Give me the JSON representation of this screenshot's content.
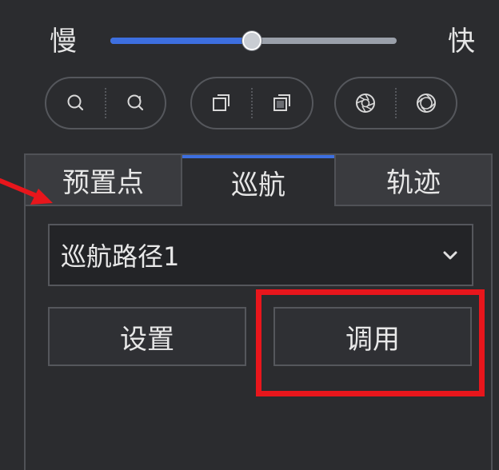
{
  "speed": {
    "slow_label": "慢",
    "fast_label": "快",
    "value_fraction": 0.495,
    "fill_color": "#3d6fe0"
  },
  "controls": {
    "zoom": {
      "in_icon": "zoom-in-icon",
      "out_icon": "zoom-out-icon"
    },
    "focus": {
      "near_icon": "focus-near-icon",
      "far_icon": "focus-far-icon"
    },
    "iris": {
      "open_icon": "iris-open-icon",
      "close_icon": "iris-close-icon"
    }
  },
  "tabs": [
    {
      "label": "预置点",
      "active": false
    },
    {
      "label": "巡航",
      "active": true
    },
    {
      "label": "轨迹",
      "active": false
    }
  ],
  "cruise": {
    "selected_path": "巡航路径1",
    "set_label": "设置",
    "call_label": "调用"
  },
  "colors": {
    "accent": "#3d6fe0",
    "annotation": "#e8161c"
  }
}
